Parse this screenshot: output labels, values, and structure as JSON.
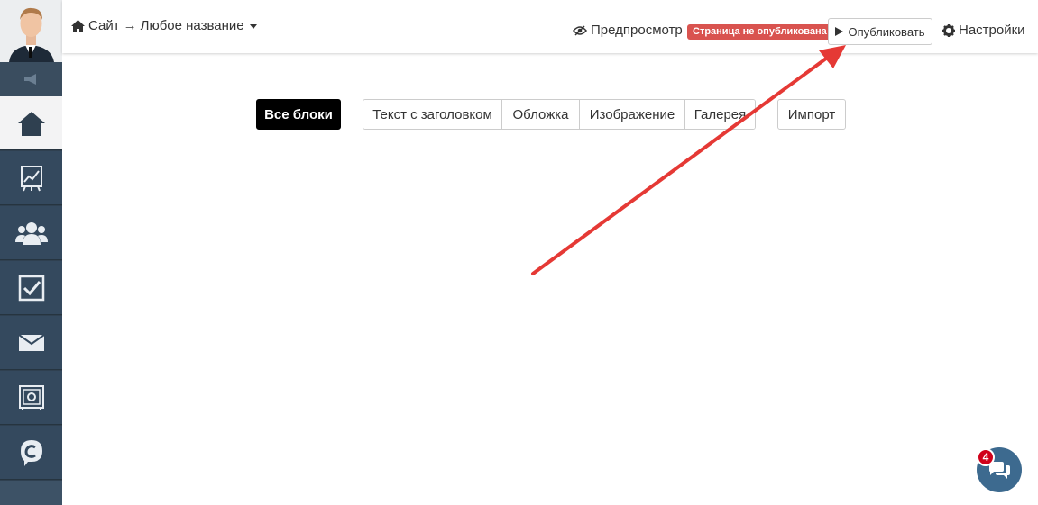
{
  "header": {
    "breadcrumb_site": "Сайт",
    "breadcrumb_arrow": "→",
    "breadcrumb_page": "Любое название",
    "preview_label": "Предпросмотр",
    "status_badge": "Страница не опубликована",
    "publish_label": "Опубликовать",
    "settings_label": "Настройки"
  },
  "filters": {
    "all_blocks": "Все блоки",
    "categories": [
      "Текст с заголовком",
      "Обложка",
      "Изображение",
      "Галерея"
    ],
    "import_label": "Импорт"
  },
  "sidebar": {
    "items": [
      {
        "icon": "home-icon",
        "active": true
      },
      {
        "icon": "chart-icon",
        "active": false
      },
      {
        "icon": "users-icon",
        "active": false
      },
      {
        "icon": "checkbox-icon",
        "active": false
      },
      {
        "icon": "mail-icon",
        "active": false
      },
      {
        "icon": "safe-icon",
        "active": false
      },
      {
        "icon": "chat-c-icon",
        "active": false
      }
    ]
  },
  "chat": {
    "unread_count": "4"
  },
  "colors": {
    "sidebar": "#2f4050",
    "badge_red": "#d9534f",
    "arrow_red": "#e53935",
    "chat_blue": "#3d6a8f"
  }
}
